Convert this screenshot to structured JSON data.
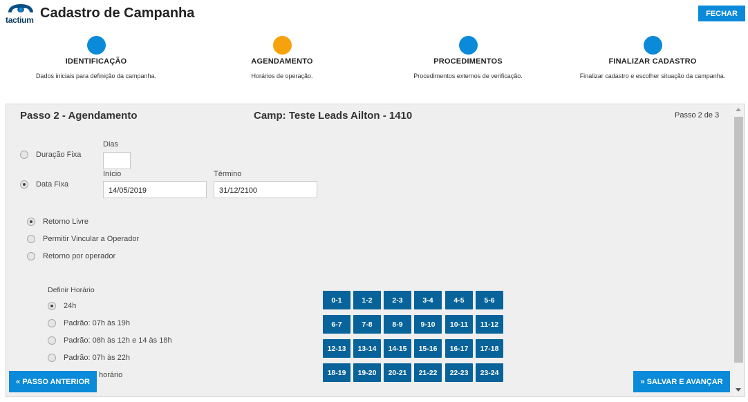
{
  "header": {
    "logo_text": "tactium",
    "title": "Cadastro de Campanha",
    "close_label": "FECHAR"
  },
  "steps": [
    {
      "title": "IDENTIFICAÇÃO",
      "desc": "Dados iniciais para definição da campanha.",
      "color": "#0a8ad8"
    },
    {
      "title": "AGENDAMENTO",
      "desc": "Horários de operação.",
      "color": "#f5a20c"
    },
    {
      "title": "PROCEDIMENTOS",
      "desc": "Procedimentos externos de verificação.",
      "color": "#0a8ad8"
    },
    {
      "title": "FINALIZAR CADASTRO",
      "desc": "Finalizar cadastro e escolher situação da campanha.",
      "color": "#0a8ad8"
    }
  ],
  "panel": {
    "title": "Passo 2 - Agendamento",
    "campaign": "Camp: Teste Leads Ailton - 1410",
    "step_indicator": "Passo 2 de 3"
  },
  "duration": {
    "fixed_label": "Duração Fixa",
    "days_label": "Dias",
    "days_value": "",
    "date_label": "Data Fixa",
    "start_label": "Início",
    "start_value": "14/05/2019",
    "end_label": "Término",
    "end_value": "31/12/2100",
    "selected": "Data Fixa"
  },
  "return_options": {
    "items": [
      "Retorno Livre",
      "Permitir Vincular a Operador",
      "Retorno por operador"
    ],
    "selected": "Retorno Livre"
  },
  "schedule": {
    "label": "Definir Horário",
    "items": [
      "24h",
      "Padrão: 07h às 19h",
      "Padrão: 08h às 12h e 14 às 18h",
      "Padrão: 07h às 22h",
      "horário"
    ],
    "selected": "24h"
  },
  "hours": [
    "0-1",
    "1-2",
    "2-3",
    "3-4",
    "4-5",
    "5-6",
    "6-7",
    "7-8",
    "8-9",
    "9-10",
    "10-11",
    "11-12",
    "12-13",
    "13-14",
    "14-15",
    "15-16",
    "16-17",
    "17-18",
    "18-19",
    "19-20",
    "20-21",
    "21-22",
    "22-23",
    "23-24"
  ],
  "footer": {
    "prev_label": "« PASSO ANTERIOR",
    "next_label": "» SALVAR E AVANÇAR"
  },
  "colors": {
    "accent": "#0a8ad8",
    "active_step": "#f5a20c",
    "hour_button": "#07639a"
  }
}
